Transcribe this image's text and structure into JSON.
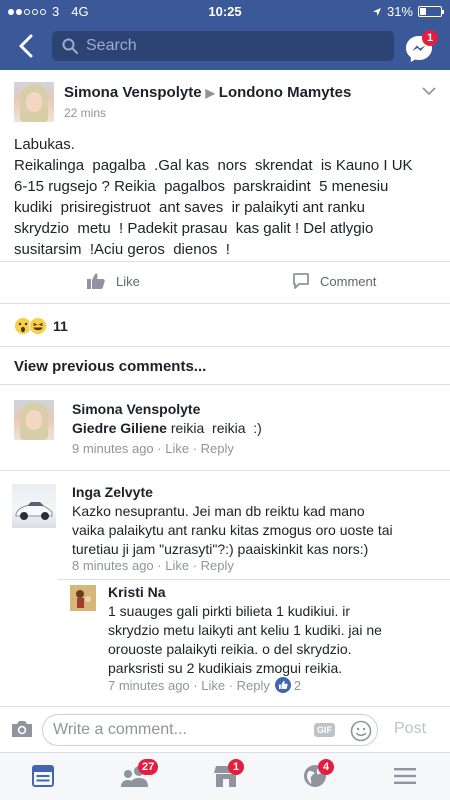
{
  "status_bar": {
    "carrier": "3",
    "network": "4G",
    "time": "10:25",
    "battery": "31%",
    "battery_level": 0.31
  },
  "header": {
    "search_placeholder": "Search",
    "messenger_badge": "1",
    "icons": [
      "back-arrow-icon",
      "search-icon",
      "messenger-icon"
    ]
  },
  "post": {
    "author": "Simona Venspolyte",
    "target_group": "Londono Mamytes",
    "time": "22 mins",
    "body": "Labukas.\nReikalinga  pagalba  .Gal kas  nors  skrendat  is Kauno I UK\n6-15 rugsejo ? Reikia  pagalbos  parskraidint  5 menesiu\nkudiki  prisiregistruot  ant saves  ir palaikyti ant ranku\nskrydzio  metu  ! Padekit prasau  kas galit ! Del atlygio\nsusitarsim  !Aciu geros  dienos  !",
    "like_label": "Like",
    "comment_label": "Comment",
    "reaction_count": "11",
    "reactions": [
      "wow-reaction",
      "haha-reaction"
    ]
  },
  "view_previous": "View previous comments...",
  "comments": [
    {
      "name": "Simona Venspolyte",
      "mention": "Giedre Giliene",
      "text": " reikia  reikia  :)",
      "time": "9 minutes ago",
      "like": "Like",
      "reply": "Reply"
    },
    {
      "name": "Inga Zelvyte",
      "text": "Kazko nesuprantu. Jei man db reiktu kad mano\nvaika palaikytu ant ranku kitas zmogus oro uoste tai\nturetiau ji jam \"uzrasyti\"?:) paaiskinkit kas nors:)",
      "time": "8 minutes ago",
      "like": "Like",
      "reply": "Reply"
    },
    {
      "name": "Kristi Na",
      "text": "1 suauges gali pirkti bilieta 1 kudikiui. ir\nskrydzio metu laikyti ant keliu 1 kudiki. jai ne\norouoste palaikyti reikia. o del skrydzio.\nparksristi su 2 kudikiais zmogui reikia.",
      "time": "7 minutes ago",
      "like": "Like",
      "reply": "Reply",
      "like_count": "2"
    }
  ],
  "composer": {
    "placeholder": "Write a comment...",
    "gif_label": "GIF",
    "post_label": "Post"
  },
  "tab_bar": {
    "tabs": [
      {
        "icon": "news-feed-icon",
        "badge": ""
      },
      {
        "icon": "friend-requests-icon",
        "badge": "27"
      },
      {
        "icon": "marketplace-icon",
        "badge": "1"
      },
      {
        "icon": "notifications-globe-icon",
        "badge": "4"
      },
      {
        "icon": "menu-icon",
        "badge": ""
      }
    ]
  },
  "colors": {
    "brand": "#3b5998",
    "badge": "#e41e3f",
    "text": "#1d2129",
    "meta": "#90949c"
  }
}
